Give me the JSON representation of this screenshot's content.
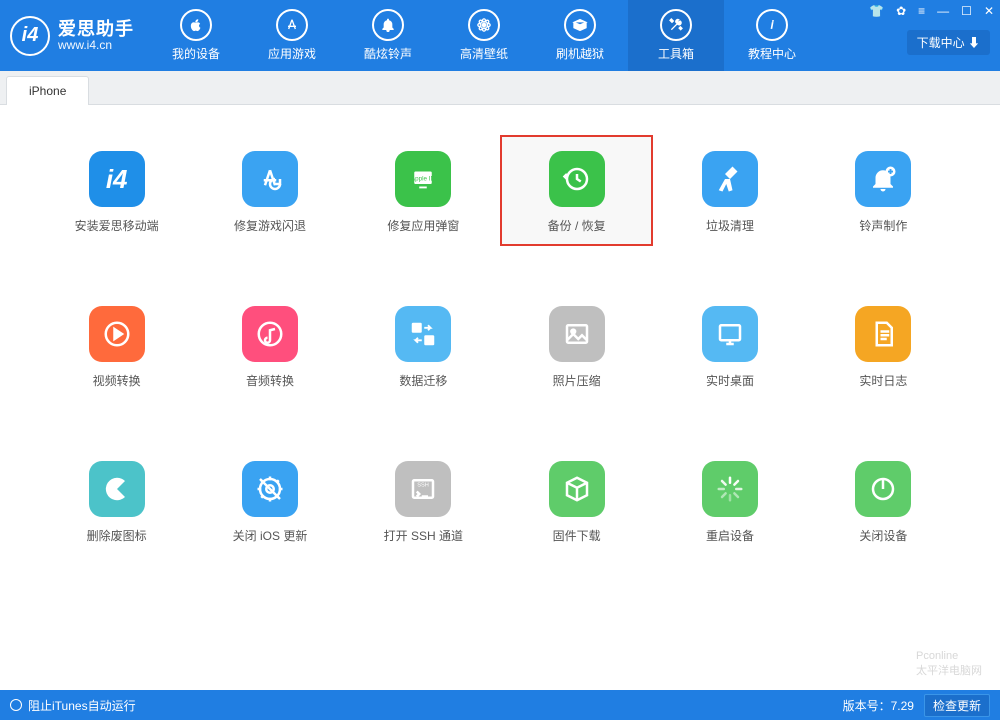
{
  "header": {
    "brand_cn": "爱思助手",
    "brand_en": "www.i4.cn",
    "download_center": "下载中心 ⬇",
    "nav": [
      {
        "label": "我的设备"
      },
      {
        "label": "应用游戏"
      },
      {
        "label": "酷炫铃声"
      },
      {
        "label": "高清壁纸"
      },
      {
        "label": "刷机越狱"
      },
      {
        "label": "工具箱"
      },
      {
        "label": "教程中心"
      }
    ]
  },
  "tabs": {
    "active": "iPhone"
  },
  "tools": [
    {
      "label": "安装爱思移动端"
    },
    {
      "label": "修复游戏闪退"
    },
    {
      "label": "修复应用弹窗"
    },
    {
      "label": "备份 / 恢复"
    },
    {
      "label": "垃圾清理"
    },
    {
      "label": "铃声制作"
    },
    {
      "label": "视频转换"
    },
    {
      "label": "音频转换"
    },
    {
      "label": "数据迁移"
    },
    {
      "label": "照片压缩"
    },
    {
      "label": "实时桌面"
    },
    {
      "label": "实时日志"
    },
    {
      "label": "删除废图标"
    },
    {
      "label": "关闭 iOS 更新"
    },
    {
      "label": "打开 SSH 通道"
    },
    {
      "label": "固件下载"
    },
    {
      "label": "重启设备"
    },
    {
      "label": "关闭设备"
    }
  ],
  "footer": {
    "itunes_block": "阻止iTunes自动运行",
    "version_label": "版本号：7.29",
    "check_update": "检查更新"
  },
  "watermark": "Pconline\n太平洋电脑网"
}
